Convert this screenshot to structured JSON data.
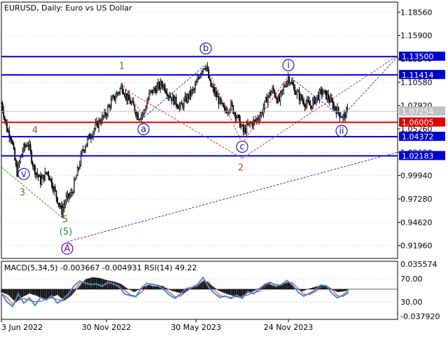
{
  "header": {
    "title": "EURUSD, Daily:  Euro vs US Dollar"
  },
  "colors": {
    "background": "#ffffff",
    "frame": "#000000",
    "grid": "#c8c8c8",
    "candle": "#000000",
    "level_blue": "#0000cc",
    "level_red": "#dd0000",
    "label_blue_bg": "#0000cc",
    "label_red_bg": "#dd0000",
    "label_gray_bg": "#c0c0c0",
    "wave_blue": "#1f1fa8",
    "wave_red": "#a0522d",
    "wave_green": "#2e8b2e",
    "wave_purple": "#660099",
    "dashed_blue": "#1f3fcc",
    "dashed_red": "#cc3333",
    "dashed_green": "#2e8b2e",
    "dashed_purple": "#6a1fb0",
    "macd_hist": "#000000",
    "rsi_line": "#3c8fd6",
    "signal_line": "#cc2222"
  },
  "chart_data": [
    {
      "type": "candlestick",
      "symbol": "EURUSD",
      "timeframe": "Daily",
      "ylim": [
        0.905,
        1.197
      ],
      "y_ticks": [
        "1.18560",
        "1.15900",
        "1.13240",
        "1.10580",
        "1.07920",
        "1.05260",
        "1.02600",
        "0.99940",
        "0.97280",
        "0.94620",
        "0.91960"
      ],
      "x_ticks": [
        "3 Jun 2022",
        "30 Nov 2022",
        "30 May 2023",
        "24 Nov 2023"
      ],
      "price_path": [
        [
          0,
          1.082
        ],
        [
          8,
          1.052
        ],
        [
          14,
          1.044
        ],
        [
          22,
          1.002
        ],
        [
          30,
          1.028
        ],
        [
          38,
          1.037
        ],
        [
          46,
          1.009
        ],
        [
          56,
          0.993
        ],
        [
          66,
          1.004
        ],
        [
          76,
          0.982
        ],
        [
          86,
          0.958
        ],
        [
          92,
          0.972
        ],
        [
          100,
          0.978
        ],
        [
          108,
          1.001
        ],
        [
          116,
          1.028
        ],
        [
          124,
          1.041
        ],
        [
          132,
          1.052
        ],
        [
          140,
          1.061
        ],
        [
          148,
          1.068
        ],
        [
          156,
          1.082
        ],
        [
          164,
          1.091
        ],
        [
          172,
          1.101
        ],
        [
          180,
          1.087
        ],
        [
          188,
          1.079
        ],
        [
          196,
          1.066
        ],
        [
          204,
          1.072
        ],
        [
          212,
          1.093
        ],
        [
          220,
          1.098
        ],
        [
          230,
          1.104
        ],
        [
          240,
          1.091
        ],
        [
          248,
          1.084
        ],
        [
          256,
          1.077
        ],
        [
          266,
          1.089
        ],
        [
          276,
          1.098
        ],
        [
          286,
          1.121
        ],
        [
          292,
          1.126
        ],
        [
          298,
          1.103
        ],
        [
          308,
          1.089
        ],
        [
          318,
          1.073
        ],
        [
          328,
          1.079
        ],
        [
          338,
          1.064
        ],
        [
          346,
          1.049
        ],
        [
          354,
          1.058
        ],
        [
          362,
          1.061
        ],
        [
          372,
          1.071
        ],
        [
          380,
          1.089
        ],
        [
          388,
          1.097
        ],
        [
          396,
          1.083
        ],
        [
          404,
          1.101
        ],
        [
          410,
          1.112
        ],
        [
          418,
          1.098
        ],
        [
          426,
          1.089
        ],
        [
          434,
          1.082
        ],
        [
          442,
          1.079
        ],
        [
          450,
          1.088
        ],
        [
          458,
          1.095
        ],
        [
          466,
          1.089
        ],
        [
          474,
          1.079
        ],
        [
          482,
          1.071
        ],
        [
          488,
          1.066
        ],
        [
          496,
          1.074
        ]
      ],
      "levels": [
        {
          "value": 1.135,
          "label": "1.13500",
          "color": "blue"
        },
        {
          "value": 1.11414,
          "label": "1.11414",
          "color": "blue"
        },
        {
          "value": 1.06005,
          "label": "1.06005",
          "color": "red"
        },
        {
          "value": 1.04372,
          "label": "1.04372",
          "color": "blue"
        },
        {
          "value": 1.02183,
          "label": "1.02183",
          "color": "blue"
        }
      ],
      "current_price": {
        "value": 1.07254,
        "label": "1.07254"
      },
      "wave_labels": [
        {
          "text": "v",
          "circled": true,
          "color": "blue",
          "price": 0.998,
          "x": 32
        },
        {
          "text": "3",
          "circled": false,
          "color": "red",
          "price": 0.977,
          "x": 30
        },
        {
          "text": "4",
          "circled": false,
          "color": "red",
          "price": 1.048,
          "x": 48
        },
        {
          "text": "5",
          "circled": false,
          "color": "red",
          "price": 0.946,
          "x": 91
        },
        {
          "text": "(5)",
          "circled": false,
          "color": "green",
          "price": 0.932,
          "x": 92
        },
        {
          "text": "A",
          "circled": true,
          "color": "purple",
          "price": 0.913,
          "x": 94
        },
        {
          "text": "1",
          "circled": false,
          "color": "red",
          "price": 1.121,
          "x": 172
        },
        {
          "text": "a",
          "circled": true,
          "color": "blue",
          "price": 1.049,
          "x": 203
        },
        {
          "text": "b",
          "circled": true,
          "color": "blue",
          "price": 1.141,
          "x": 292
        },
        {
          "text": "c",
          "circled": true,
          "color": "blue",
          "price": 1.029,
          "x": 344
        },
        {
          "text": "2",
          "circled": false,
          "color": "red",
          "price": 1.005,
          "x": 342
        },
        {
          "text": "i",
          "circled": true,
          "color": "blue",
          "price": 1.122,
          "x": 410
        },
        {
          "text": "ii",
          "circled": true,
          "color": "blue",
          "price": 1.047,
          "x": 486
        }
      ],
      "trend_lines": [
        {
          "style": "dashed",
          "color": "red",
          "from": [
            172,
            1.105
          ],
          "to": [
            204,
            1.066
          ]
        },
        {
          "style": "dashed",
          "color": "blue",
          "from": [
            204,
            1.066
          ],
          "to": [
            292,
            1.126
          ]
        },
        {
          "style": "dashed",
          "color": "red",
          "from": [
            292,
            1.126
          ],
          "to": [
            344,
            1.036
          ]
        },
        {
          "style": "dashed",
          "color": "red",
          "from": [
            344,
            1.036
          ],
          "to": [
            410,
            1.113
          ]
        },
        {
          "style": "dashed",
          "color": "blue",
          "from": [
            410,
            1.113
          ],
          "to": [
            486,
            1.066
          ]
        },
        {
          "style": "dashed",
          "color": "blue",
          "from": [
            486,
            1.066
          ],
          "to": [
            566,
            1.135
          ]
        },
        {
          "style": "dashed",
          "color": "red",
          "from": [
            186,
            1.093
          ],
          "to": [
            344,
            1.019
          ]
        },
        {
          "style": "dashed",
          "color": "red",
          "from": [
            344,
            1.019
          ],
          "to": [
            566,
            1.136
          ]
        },
        {
          "style": "dashed",
          "color": "green",
          "from": [
            0,
            1.009
          ],
          "to": [
            86,
            0.952
          ]
        },
        {
          "style": "dashed",
          "color": "purple",
          "from": [
            94,
            0.924
          ],
          "to": [
            566,
            1.026
          ]
        }
      ]
    },
    {
      "type": "indicator",
      "title": "MACD(5,34,5) -0.003667 -0.004931 RSI(14) 49.22",
      "ylim": [
        -0.0425,
        0.0395
      ],
      "y_ticks": [
        "0.035574",
        "70.00",
        "30.00",
        "-0.037920"
      ],
      "rsi_ylim": [
        0,
        100
      ],
      "macd_series": [
        [
          0,
          -0.004
        ],
        [
          10,
          -0.008
        ],
        [
          20,
          -0.018
        ],
        [
          30,
          -0.011
        ],
        [
          40,
          -0.006
        ],
        [
          50,
          -0.009
        ],
        [
          60,
          -0.014
        ],
        [
          70,
          -0.012
        ],
        [
          80,
          -0.008
        ],
        [
          90,
          -0.016
        ],
        [
          100,
          -0.009
        ],
        [
          110,
          0.003
        ],
        [
          120,
          0.014
        ],
        [
          130,
          0.017
        ],
        [
          140,
          0.016
        ],
        [
          150,
          0.013
        ],
        [
          160,
          0.011
        ],
        [
          170,
          0.008
        ],
        [
          180,
          0.001
        ],
        [
          190,
          -0.004
        ],
        [
          200,
          0.002
        ],
        [
          210,
          0.006
        ],
        [
          220,
          0.004
        ],
        [
          230,
          0.005
        ],
        [
          240,
          -0.001
        ],
        [
          250,
          -0.004
        ],
        [
          260,
          -0.006
        ],
        [
          270,
          0.001
        ],
        [
          280,
          0.004
        ],
        [
          290,
          0.013
        ],
        [
          300,
          0.006
        ],
        [
          310,
          -0.002
        ],
        [
          320,
          -0.006
        ],
        [
          330,
          -0.009
        ],
        [
          340,
          -0.012
        ],
        [
          350,
          -0.006
        ],
        [
          360,
          -0.003
        ],
        [
          370,
          0.003
        ],
        [
          380,
          0.009
        ],
        [
          390,
          0.004
        ],
        [
          400,
          0.007
        ],
        [
          410,
          0.01
        ],
        [
          420,
          0.002
        ],
        [
          430,
          -0.003
        ],
        [
          440,
          0.001
        ],
        [
          450,
          0.004
        ],
        [
          460,
          0.006
        ],
        [
          470,
          0.001
        ],
        [
          480,
          -0.004
        ],
        [
          490,
          -0.003
        ],
        [
          496,
          -0.001
        ]
      ],
      "rsi_series": [
        [
          0,
          45
        ],
        [
          8,
          30
        ],
        [
          16,
          22
        ],
        [
          24,
          44
        ],
        [
          32,
          28
        ],
        [
          40,
          37
        ],
        [
          48,
          24
        ],
        [
          56,
          38
        ],
        [
          64,
          33
        ],
        [
          72,
          41
        ],
        [
          80,
          28
        ],
        [
          88,
          35
        ],
        [
          96,
          44
        ],
        [
          104,
          58
        ],
        [
          112,
          66
        ],
        [
          120,
          62
        ],
        [
          128,
          60
        ],
        [
          136,
          61
        ],
        [
          144,
          57
        ],
        [
          152,
          64
        ],
        [
          160,
          61
        ],
        [
          168,
          56
        ],
        [
          176,
          44
        ],
        [
          184,
          41
        ],
        [
          192,
          39
        ],
        [
          200,
          54
        ],
        [
          208,
          62
        ],
        [
          216,
          60
        ],
        [
          224,
          58
        ],
        [
          232,
          51
        ],
        [
          240,
          42
        ],
        [
          248,
          36
        ],
        [
          256,
          44
        ],
        [
          264,
          53
        ],
        [
          272,
          55
        ],
        [
          280,
          60
        ],
        [
          288,
          72
        ],
        [
          296,
          56
        ],
        [
          304,
          45
        ],
        [
          312,
          38
        ],
        [
          320,
          40
        ],
        [
          328,
          36
        ],
        [
          336,
          42
        ],
        [
          344,
          36
        ],
        [
          352,
          48
        ],
        [
          360,
          44
        ],
        [
          368,
          52
        ],
        [
          376,
          60
        ],
        [
          384,
          64
        ],
        [
          392,
          57
        ],
        [
          400,
          60
        ],
        [
          408,
          67
        ],
        [
          416,
          59
        ],
        [
          424,
          47
        ],
        [
          432,
          40
        ],
        [
          440,
          45
        ],
        [
          448,
          50
        ],
        [
          456,
          59
        ],
        [
          464,
          58
        ],
        [
          472,
          45
        ],
        [
          480,
          37
        ],
        [
          488,
          42
        ],
        [
          496,
          49
        ]
      ]
    }
  ]
}
